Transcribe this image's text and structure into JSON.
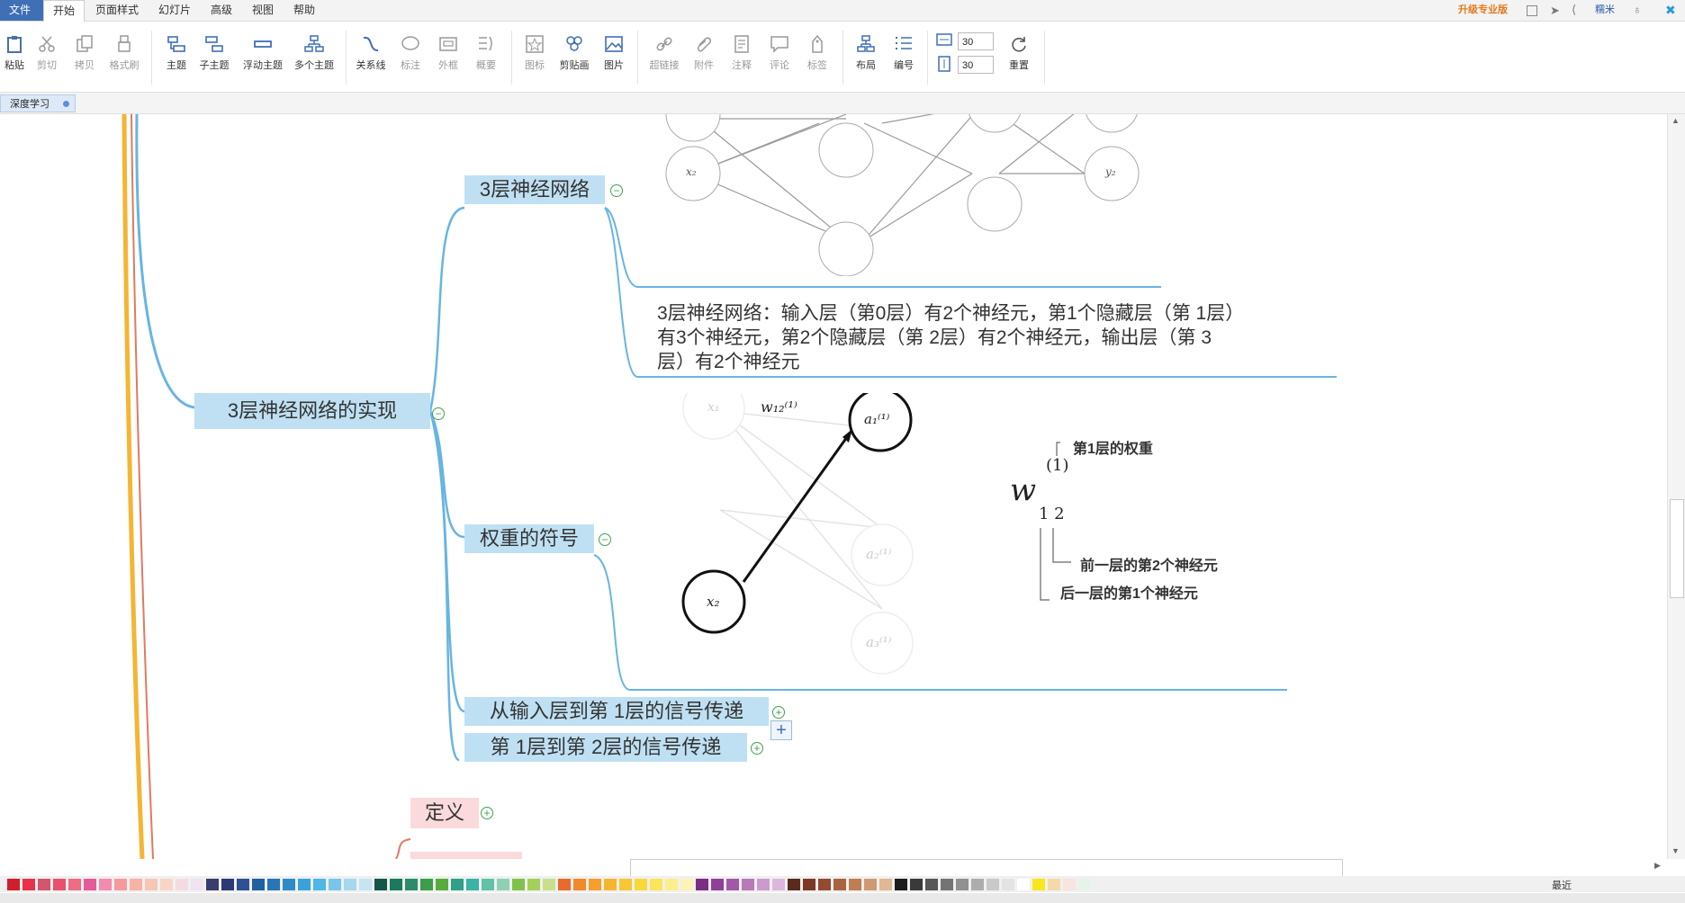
{
  "menubar": {
    "file": "文件",
    "items": [
      "开始",
      "页面样式",
      "幻灯片",
      "高级",
      "视图",
      "帮助"
    ],
    "upgrade": "升级专业版",
    "user": "糯米"
  },
  "toolbar": {
    "buttons": [
      {
        "label": "粘贴",
        "icon": "paste-icon"
      },
      {
        "label": "剪切",
        "icon": "cut-icon"
      },
      {
        "label": "拷贝",
        "icon": "copy-icon"
      },
      {
        "label": "格式刷",
        "icon": "format-painter-icon"
      },
      {
        "label": "主题",
        "icon": "topic-icon"
      },
      {
        "label": "子主题",
        "icon": "subtopic-icon"
      },
      {
        "label": "浮动主题",
        "icon": "floating-topic-icon"
      },
      {
        "label": "多个主题",
        "icon": "multi-topic-icon"
      },
      {
        "label": "关系线",
        "icon": "relationship-icon"
      },
      {
        "label": "标注",
        "icon": "callout-icon"
      },
      {
        "label": "外框",
        "icon": "boundary-icon"
      },
      {
        "label": "概要",
        "icon": "summary-icon"
      },
      {
        "label": "图标",
        "icon": "marker-icon"
      },
      {
        "label": "剪贴画",
        "icon": "clipart-icon"
      },
      {
        "label": "图片",
        "icon": "image-icon"
      },
      {
        "label": "超链接",
        "icon": "hyperlink-icon"
      },
      {
        "label": "附件",
        "icon": "attachment-icon"
      },
      {
        "label": "注释",
        "icon": "note-icon"
      },
      {
        "label": "评论",
        "icon": "comment-icon"
      },
      {
        "label": "标签",
        "icon": "label-icon"
      },
      {
        "label": "布局",
        "icon": "layout-icon"
      },
      {
        "label": "编号",
        "icon": "numbering-icon"
      },
      {
        "label": "重置",
        "icon": "reset-icon"
      }
    ],
    "spacing_h": "30",
    "spacing_v": "30"
  },
  "tabs": {
    "document": "深度学习"
  },
  "mindmap": {
    "main_topic": "3层神经网络的实现",
    "sub_topics": {
      "three_layer": "3层神经网络",
      "weights": "权重的符号",
      "input_to_1": "从输入层到第 1层的信号传递",
      "layer1_to_2": "第 1层到第 2层的信号传递"
    },
    "note_text_lines": [
      "3层神经网络：输入层（第0层）有2个神经元，第1个隐藏层（第 1层）",
      "有3个神经元，第2个隐藏层（第 2层）有2个神经元，输出层（第 3",
      "层）有2个神经元"
    ],
    "definition": "定义",
    "weight_diagram": {
      "symbol": "w",
      "superscript": "(1)",
      "subscript": "1 2",
      "label_layer": "第1层的权重",
      "label_prev": "前一层的第2个神经元",
      "label_next": "后一层的第1个神经元"
    },
    "network_labels": {
      "x1": "x₁",
      "x2": "x₂",
      "y2": "y₂",
      "w12": "w₁₂⁽¹⁾",
      "a1": "a₁⁽¹⁾",
      "a2": "a₂⁽¹⁾",
      "a3": "a₃⁽¹⁾"
    }
  },
  "palette": {
    "recent_label": "最近",
    "colors": [
      "#d21e2b",
      "#e8314a",
      "#d3566a",
      "#e9506b",
      "#ec6d84",
      "#e45a9a",
      "#f28bb0",
      "#f59a9c",
      "#f7b1a5",
      "#f6c7b3",
      "#f9d5c6",
      "#f4dbe2",
      "#f1e3ef",
      "#3b3b6d",
      "#2b3a75",
      "#2f4f96",
      "#1f5fa4",
      "#2676b8",
      "#2e8bc9",
      "#39a2db",
      "#4db7e7",
      "#77c6ea",
      "#a3d8ef",
      "#c4e5f2",
      "#13564a",
      "#1b7a5b",
      "#2b8b6b",
      "#3a9e4a",
      "#58ad3a",
      "#2fa08a",
      "#39b3a4",
      "#61c2a8",
      "#8dd1b4",
      "#7fc24a",
      "#a4d05a",
      "#c9e08a",
      "#e86a2c",
      "#f08a2a",
      "#f4a02b",
      "#f7b52e",
      "#f9c733",
      "#fad838",
      "#fbe55a",
      "#fcee8a",
      "#fdf3b4",
      "#7b2d86",
      "#8f3f9b",
      "#a457a9",
      "#b978b8",
      "#cd9ad0",
      "#dbb7de",
      "#5a2b1c",
      "#7b3a24",
      "#934b30",
      "#a9643f",
      "#bf7d52",
      "#cf9a72",
      "#dfb895",
      "#1c1c1c",
      "#3a3a3a",
      "#575757",
      "#747474",
      "#919191",
      "#adadad",
      "#c9c9c9",
      "#e3e3e3",
      "#ffffff",
      "#f8e71c",
      "#f5d9a8",
      "#f8e4e0",
      "#e6f3ea"
    ]
  }
}
